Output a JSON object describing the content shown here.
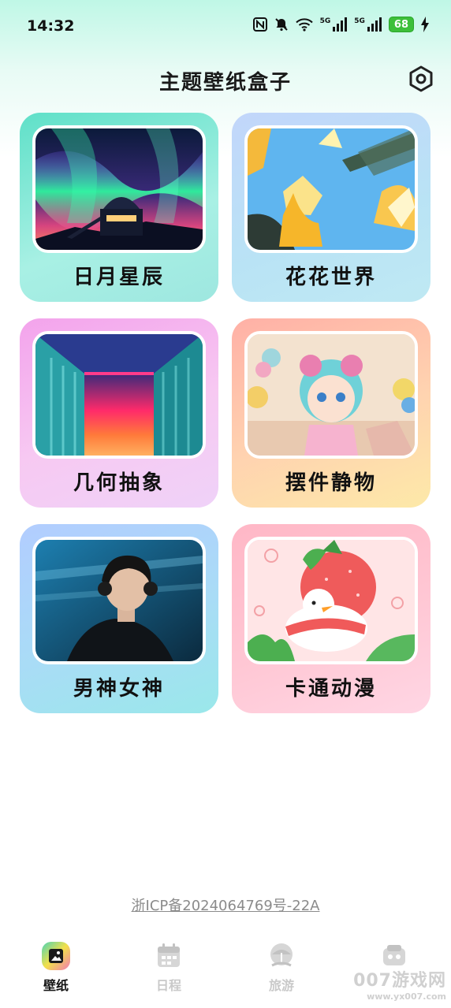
{
  "status_bar": {
    "time": "14:32",
    "battery": "68",
    "network_5g_1": "5G",
    "network_5g_2": "5G",
    "icons": [
      "nfc-icon",
      "mute-bell-icon",
      "wifi-icon",
      "signal-icon",
      "signal-icon",
      "battery-icon",
      "charging-icon"
    ]
  },
  "header": {
    "title": "主题壁纸盒子",
    "settings_icon": "hexagon-gear-icon"
  },
  "categories": [
    {
      "label": "日月星辰",
      "image": "aurora-observatory-photo",
      "bg": "#7ee6cf"
    },
    {
      "label": "花花世界",
      "image": "daffodil-blue-sky-photo",
      "bg": "#b7d7f7"
    },
    {
      "label": "几何抽象",
      "image": "neon-corridor-photo",
      "bg": "#f4b6ee"
    },
    {
      "label": "摆件静物",
      "image": "doll-figurine-photo",
      "bg": "#ffc9b4"
    },
    {
      "label": "男神女神",
      "image": "male-portrait-photo",
      "bg": "#b9d3ff"
    },
    {
      "label": "卡通动漫",
      "image": "cartoon-strawberry-duck",
      "bg": "#ffc0cb"
    }
  ],
  "footer": {
    "icp": "浙ICP备2024064769号-22A"
  },
  "bottom_nav": {
    "items": [
      {
        "label": "壁纸",
        "icon": "wallpaper-icon",
        "active": true
      },
      {
        "label": "日程",
        "icon": "calendar-icon",
        "active": false
      },
      {
        "label": "旅游",
        "icon": "travel-icon",
        "active": false
      },
      {
        "label": "",
        "icon": "profile-icon",
        "active": false
      }
    ]
  },
  "watermark": {
    "text": "007游戏网",
    "sub": "www.yx007.com"
  },
  "colors": {
    "accent": "#3dbf3a",
    "inactive_nav": "#c9c9c9",
    "icp_text": "#8b8b8b"
  }
}
